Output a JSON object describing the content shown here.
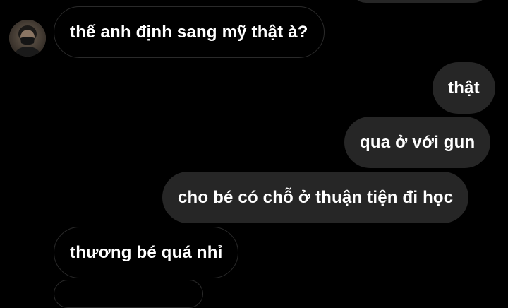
{
  "chat": {
    "messages": [
      {
        "sender": "other",
        "text": "thế anh định sang mỹ thật à?"
      },
      {
        "sender": "me",
        "text": "thật"
      },
      {
        "sender": "me",
        "text": "qua ở với gun"
      },
      {
        "sender": "me",
        "text": "cho bé có chỗ ở thuận tiện đi học"
      },
      {
        "sender": "other",
        "text": "thương bé quá nhỉ"
      }
    ],
    "avatar_icon": "contact-avatar",
    "colors": {
      "background": "#000000",
      "outgoing_bubble": "#262626",
      "incoming_border": "#2a2a2a",
      "text": "#ffffff"
    }
  }
}
